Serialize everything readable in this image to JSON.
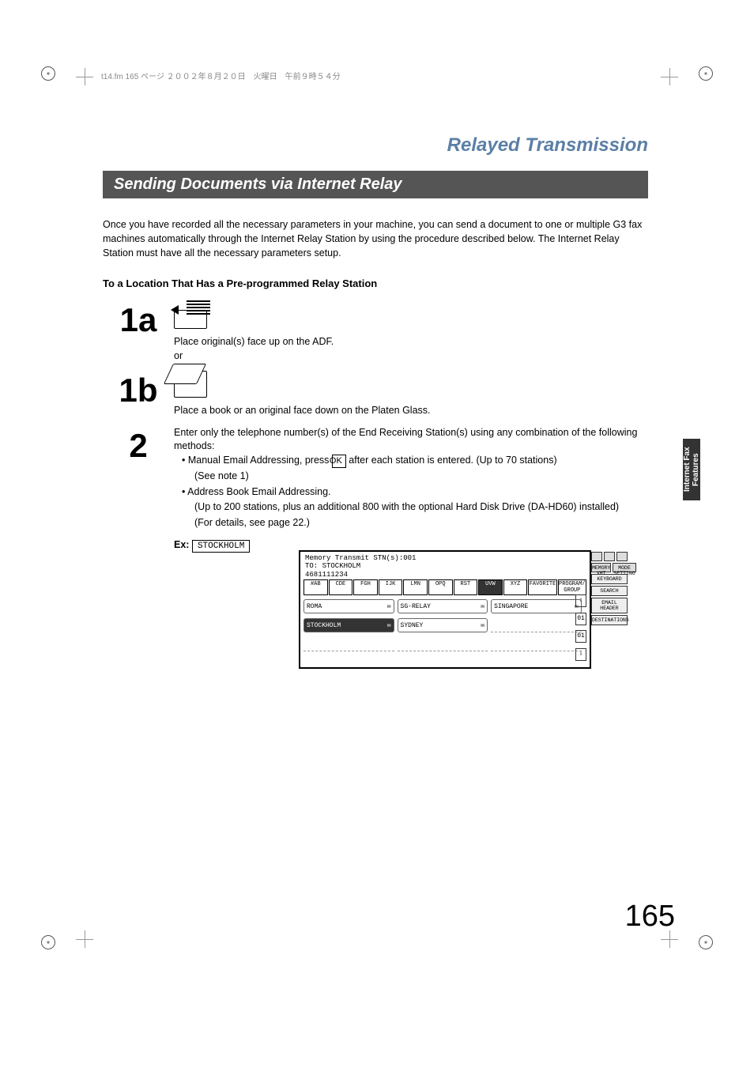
{
  "header_meta": "t14.fm  165 ページ  ２００２年８月２０日　火曜日　午前９時５４分",
  "section_title": "Relayed Transmission",
  "bar_title": "Sending Documents via Internet Relay",
  "intro": "Once you have recorded all the necessary parameters in your machine, you can send a document to one or multiple G3 fax machines automatically through the Internet Relay Station by using the procedure described below.  The Internet Relay Station must have all the necessary parameters setup.",
  "sub_heading": "To a Location That Has a Pre-programmed Relay Station",
  "step1a_num": "1a",
  "step1a_text1": "Place original(s) face up on the ADF.",
  "step1a_text2": "or",
  "step1b_num": "1b",
  "step1b_text": "Place a book or an original face down on the Platen Glass.",
  "step2_num": "2",
  "step2_intro": "Enter only the telephone number(s) of the End Receiving Station(s) using any combination of the following methods:",
  "step2_b1a": "Manual Email Addressing, press ",
  "ok_label": "OK",
  "step2_b1b": " after each station is entered. (Up to 70 stations)",
  "step2_b1c": "(See note 1)",
  "step2_b2a": "Address Book Email Addressing.",
  "step2_b2b": "(Up to 200 stations, plus an additional 800 with the optional Hard Disk Drive (DA-HD60) installed)",
  "step2_b2c": "(For details, see page 22.)",
  "ex_label": "Ex:",
  "ex_value": "STOCKHOLM",
  "panel": {
    "line1": "Memory Transmit STN(s):001",
    "line2": "TO: STOCKHOLM",
    "line3": "4681111234",
    "tabs": [
      "#AB",
      "CDE",
      "FGH",
      "IJK",
      "LMN",
      "OPQ",
      "RST",
      "UVW",
      "XYZ",
      "FAVORITE",
      "PROGRAM/\nGROUP"
    ],
    "tabs_sel_idx": 7,
    "cells": [
      {
        "label": "ROMA",
        "icon": "mail",
        "sel": false
      },
      {
        "label": "SG-RELAY",
        "icon": "mail",
        "sel": false
      },
      {
        "label": "SINGAPORE",
        "icon": "mail",
        "sel": false
      },
      {
        "label": "STOCKHOLM",
        "icon": "mail",
        "sel": true
      },
      {
        "label": "SYDNEY",
        "icon": "mail",
        "sel": false
      },
      {
        "label": "",
        "icon": "",
        "sel": false
      },
      {
        "label": "",
        "icon": "",
        "sel": false
      },
      {
        "label": "",
        "icon": "",
        "sel": false
      },
      {
        "label": "",
        "icon": "",
        "sel": false
      }
    ],
    "side_top1": "MEMORY XMT",
    "side_top2": "MODE SETTING",
    "side_btns": [
      "KEYBOARD",
      "SEARCH",
      "EMAIL HEADER",
      "DESTINATIONS"
    ],
    "scroll": {
      "up": "⇧",
      "dn": "⇩",
      "p1": "01",
      "p2": "01"
    }
  },
  "side_tab_text": "Internet Fax\nFeatures",
  "page_number": "165"
}
